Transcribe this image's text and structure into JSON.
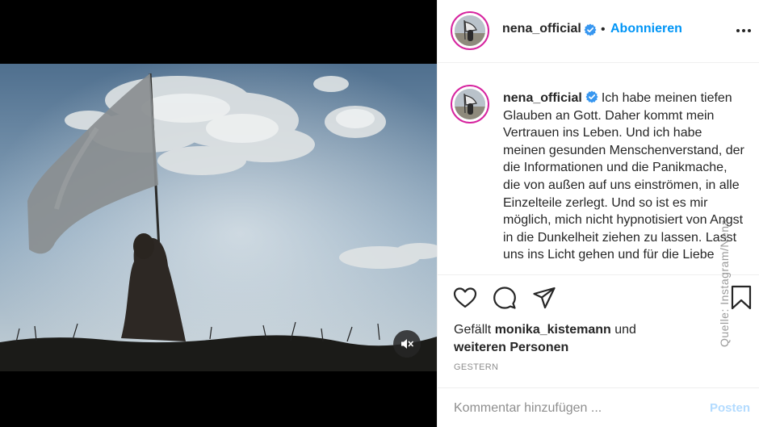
{
  "post": {
    "username": "nena_official",
    "follow_label": "Abonnieren",
    "separator": "•",
    "caption": "Ich habe meinen tiefen Glauben an Gott. Daher kommt mein Vertrauen ins Leben. Und ich habe meinen gesunden Menschenverstand, der die Informationen und die Panikmache, die von außen auf uns einströmen, in alle Einzelteile zerlegt. Und so ist es mir möglich, mich nicht hypnotisiert von Angst in die Dunkelheit ziehen zu lassen. Lasst uns ins Licht gehen und für die Liebe",
    "likes_prefix": "Gefällt",
    "liked_by": "monika_kistemann",
    "likes_and": "und",
    "likes_others": "weiteren Personen",
    "date": "GESTERN"
  },
  "comment": {
    "placeholder": "Kommentar hinzufügen ...",
    "post_label": "Posten"
  },
  "watermark": "Quelle: Instagram/Nena",
  "icons": {
    "verified": "verified-badge-icon",
    "more": "more-options-icon",
    "like": "heart-icon",
    "comment": "comment-icon",
    "share": "paper-plane-icon",
    "save": "bookmark-icon",
    "mute": "speaker-muted-icon"
  },
  "colors": {
    "accent": "#0095f6",
    "verified": "#3897f0",
    "post_disabled": "#b3dbff",
    "muted_text": "#8e8e8e"
  }
}
